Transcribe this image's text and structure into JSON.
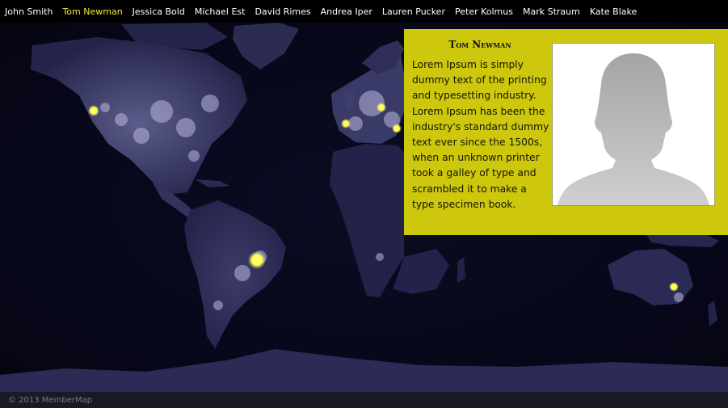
{
  "nav": {
    "members": [
      {
        "label": "John Smith",
        "active": false
      },
      {
        "label": "Tom Newman",
        "active": true
      },
      {
        "label": "Jessica Bold",
        "active": false
      },
      {
        "label": "Michael Est",
        "active": false
      },
      {
        "label": "David Rimes",
        "active": false
      },
      {
        "label": "Andrea Iper",
        "active": false
      },
      {
        "label": "Lauren Pucker",
        "active": false
      },
      {
        "label": "Peter Kolmus",
        "active": false
      },
      {
        "label": "Mark Straum",
        "active": false
      },
      {
        "label": "Kate Blake",
        "active": false
      }
    ]
  },
  "profile": {
    "name": "Tom Newman",
    "bio": "Lorem Ipsum is simply dummy text of the printing and typesetting industry. Lorem Ipsum has been the industry's standard dummy text ever since the 1500s, when an unknown printer took a galley of type and scrambled it to make a type specimen book.",
    "photo_icon": "user-silhouette-icon"
  },
  "map": {
    "style": "world map, city lights at night",
    "marker_color": "#ffff55"
  },
  "footer": {
    "copyright": "© 2013 MemberMap"
  },
  "colors": {
    "background": "#000000",
    "card": "#cdc80e",
    "nav_active": "#f2ea3a",
    "nav_text": "#ffffff"
  }
}
